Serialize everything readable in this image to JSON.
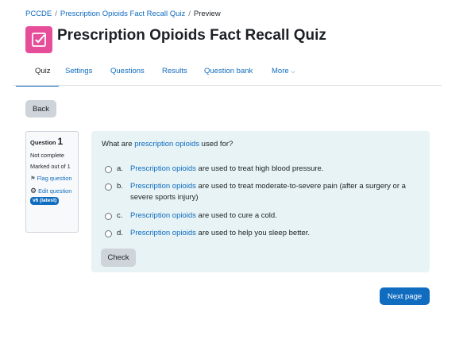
{
  "breadcrumb": {
    "items": [
      "PCCDE",
      "Prescription Opioids Fact Recall Quiz",
      "Preview"
    ]
  },
  "header": {
    "title": "Prescription Opioids Fact Recall Quiz",
    "icon": "quiz-checkbox-icon",
    "icon_color": "#e64e9a"
  },
  "tabs": [
    "Quiz",
    "Settings",
    "Questions",
    "Results",
    "Question bank",
    "More"
  ],
  "back_label": "Back",
  "question_info": {
    "label": "Question",
    "number": "1",
    "status": "Not complete",
    "marked_out_of": "Marked out of 1",
    "flag_label": "Flag question",
    "edit_label": "Edit question",
    "version": "v6 (latest)"
  },
  "question": {
    "prefix": "What are ",
    "term": "prescription opioids",
    "suffix": " used for?",
    "answers": [
      {
        "letter": "a.",
        "term": "Prescription opioids",
        "text": " are used to treat high blood pressure."
      },
      {
        "letter": "b.",
        "term": "Prescription opioids",
        "text": " are used to treat moderate-to-severe pain (after a surgery or a severe sports injury)"
      },
      {
        "letter": "c.",
        "term": "Prescription opioids",
        "text": " are used to cure a cold."
      },
      {
        "letter": "d.",
        "term": "Prescription opioids",
        "text": " are used to help you sleep better."
      }
    ]
  },
  "check_label": "Check",
  "next_label": "Next page",
  "colors": {
    "accent": "#0f6cbf",
    "question_bg": "#e7f3f5"
  }
}
